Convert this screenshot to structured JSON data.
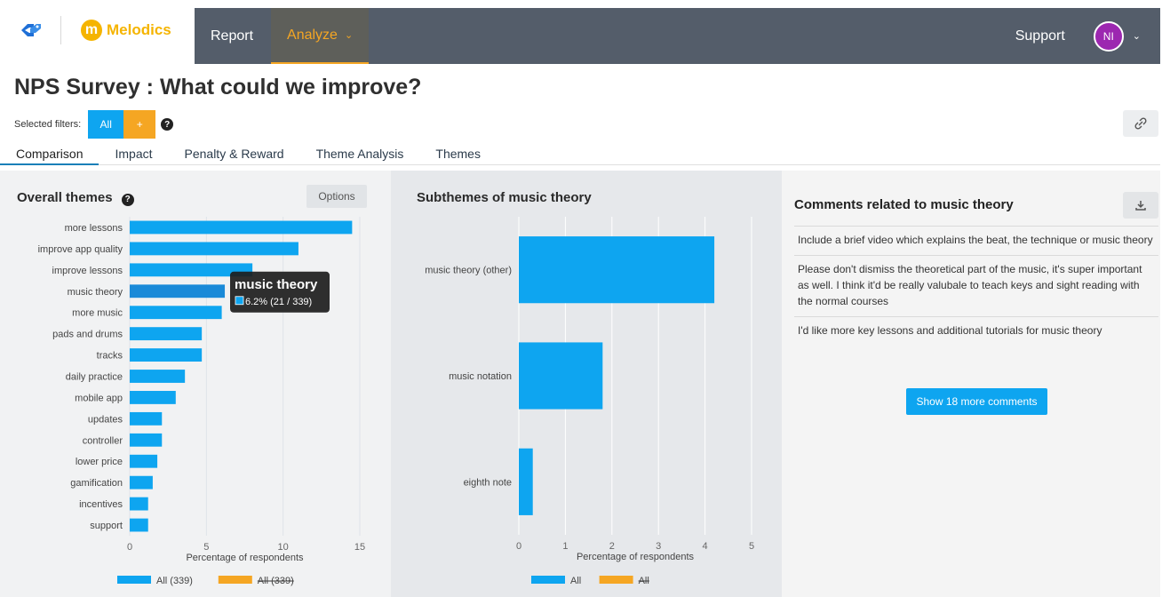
{
  "nav": {
    "brand": "Melodics",
    "report": "Report",
    "analyze": "Analyze",
    "support": "Support",
    "avatar_initials": "NI"
  },
  "page": {
    "title": "NPS Survey : What could we improve?",
    "filters_label": "Selected filters:",
    "filter_all": "All",
    "filter_add": "+",
    "help": "?"
  },
  "tabs": [
    {
      "label": "Comparison"
    },
    {
      "label": "Impact"
    },
    {
      "label": "Penalty & Reward"
    },
    {
      "label": "Theme Analysis"
    },
    {
      "label": "Themes"
    }
  ],
  "left_panel": {
    "heading": "Overall themes",
    "options": "Options"
  },
  "mid_panel": {
    "heading": "Subthemes of music theory"
  },
  "right_panel": {
    "heading": "Comments related to music theory",
    "comments": [
      "Include a brief video which explains the beat, the technique or music theory",
      "Please don't dismiss the theoretical part of the music, it's super important as well. I think it'd be really valubale to teach keys and sight reading with the normal courses",
      "I'd like more key lessons and additional tutorials for music theory"
    ],
    "show_more": "Show 18 more comments"
  },
  "colors": {
    "accent": "#0ea5f0",
    "secondary": "#f5a623",
    "nav_bg": "#545d6a"
  },
  "chart_data": [
    {
      "type": "bar",
      "orientation": "horizontal",
      "categories": [
        "more lessons",
        "improve app quality",
        "improve lessons",
        "music theory",
        "more music",
        "pads and drums",
        "tracks",
        "daily practice",
        "mobile app",
        "updates",
        "controller",
        "lower price",
        "gamification",
        "incentives",
        "support"
      ],
      "series": [
        {
          "name": "All (339)",
          "values": [
            14.5,
            11.0,
            8.0,
            6.2,
            6.0,
            4.7,
            4.7,
            3.6,
            3.0,
            2.1,
            2.1,
            1.8,
            1.5,
            1.2,
            1.2
          ]
        }
      ],
      "xlabel": "Percentage of respondents",
      "xlim": [
        0,
        15
      ],
      "xticks": [
        0,
        5,
        10,
        15
      ],
      "legend": [
        {
          "label": "All (339)",
          "color": "#0ea5f0",
          "struck": false
        },
        {
          "label": "All (339)",
          "color": "#f5a623",
          "struck": true
        }
      ],
      "tooltip": {
        "title": "music theory",
        "value": "6.2%",
        "detail": "(21 / 339)"
      },
      "highlighted": "music theory",
      "grid": true
    },
    {
      "type": "bar",
      "orientation": "horizontal",
      "categories": [
        "music theory (other)",
        "music notation",
        "eighth note"
      ],
      "series": [
        {
          "name": "All",
          "values": [
            4.2,
            1.8,
            0.3
          ]
        }
      ],
      "xlabel": "Percentage of respondents",
      "xlim": [
        0,
        5
      ],
      "xticks": [
        0,
        1,
        2,
        3,
        4,
        5
      ],
      "legend": [
        {
          "label": "All",
          "color": "#0ea5f0",
          "struck": false
        },
        {
          "label": "All",
          "color": "#f5a623",
          "struck": true
        }
      ],
      "grid": true
    }
  ]
}
